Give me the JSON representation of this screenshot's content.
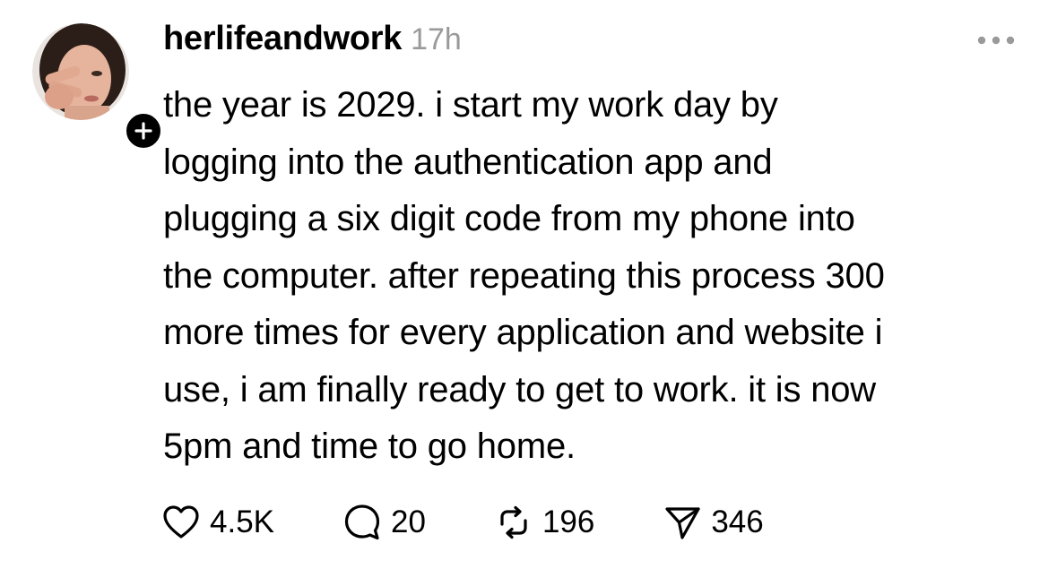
{
  "post": {
    "username": "herlifeandwork",
    "timestamp": "17h",
    "text": "the year is 2029. i start my work day by\nlogging into the authentication app and\nplugging a six digit code from my phone into\nthe computer. after repeating this process 300\nmore times for every application and website i\nuse, i am finally ready to get to work. it is now\n5pm and time to go home.",
    "avatar_icon": "profile-photo",
    "follow_icon": "plus-icon",
    "more_icon": "more-dots-icon"
  },
  "actions": {
    "likes": {
      "icon": "heart-icon",
      "count": "4.5K"
    },
    "replies": {
      "icon": "comment-icon",
      "count": "20"
    },
    "reposts": {
      "icon": "repost-icon",
      "count": "196"
    },
    "shares": {
      "icon": "send-icon",
      "count": "346"
    }
  },
  "colors": {
    "text": "#000000",
    "muted": "#9a9a9a",
    "background": "#ffffff",
    "badge": "#000000"
  }
}
